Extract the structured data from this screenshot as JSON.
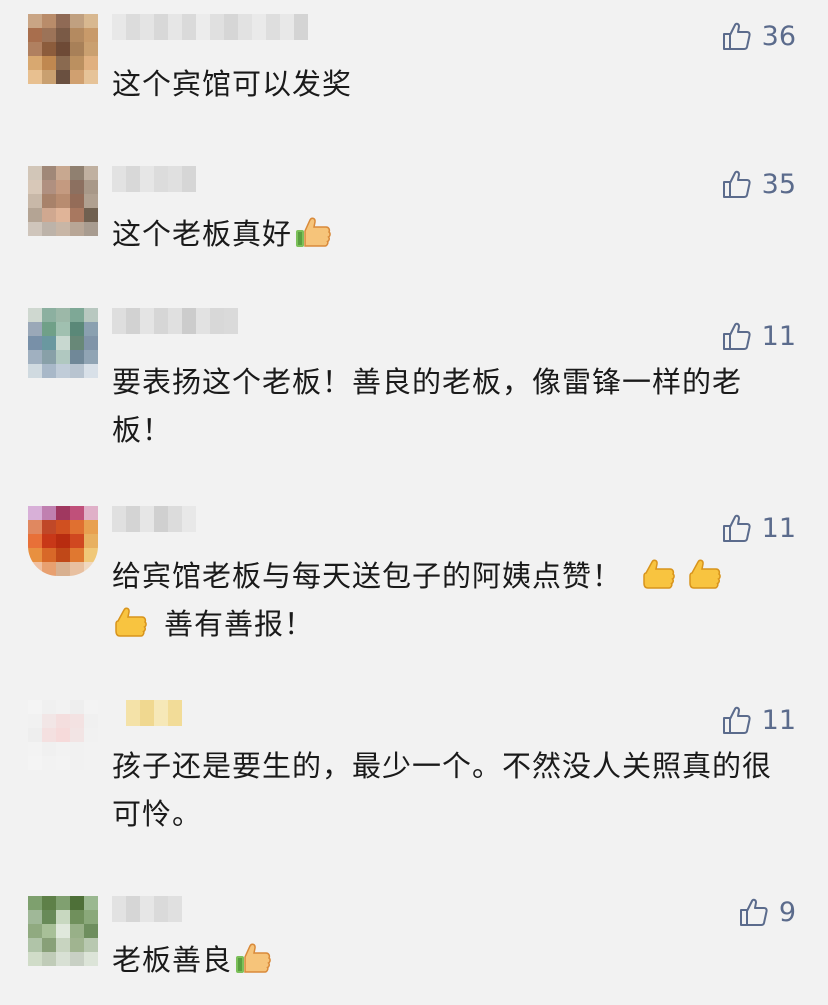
{
  "comments": [
    {
      "text": "这个宾馆可以发奖",
      "likes": "36",
      "emoji": 0,
      "avatar": [
        "#c9a585",
        "#b98c6a",
        "#8f6a55",
        "#c0a080",
        "#d8b890",
        "#a86e4d",
        "#9c7358",
        "#7a5a46",
        "#b48a60",
        "#c89a6a",
        "#b08060",
        "#8c5c3c",
        "#6e4a36",
        "#a88058",
        "#caa070",
        "#d8a870",
        "#c08850",
        "#8a6a50",
        "#bb9060",
        "#e0b080",
        "#e8c090",
        "#c9a070",
        "#6a5040",
        "#d0a070",
        "#e6c398"
      ],
      "name": [
        "#e8e8e8",
        "#dcdcdc",
        "#e4e4e4",
        "#d8d8d8",
        "#e6e6e6",
        "#dadada",
        "#ececec",
        "#e0e0e0",
        "#d6d6d6",
        "#e2e2e2",
        "#eaeaea",
        "#dedede",
        "#e8e8e8",
        "#d4d4d4"
      ]
    },
    {
      "text": "这个老板真好",
      "likes": "35",
      "emoji": 1,
      "avatar": [
        "#d2c6b8",
        "#a08878",
        "#c8a890",
        "#908070",
        "#c0b0a0",
        "#d8c8b8",
        "#b09080",
        "#c49a80",
        "#8c7060",
        "#a89888",
        "#c8b8a8",
        "#a8826a",
        "#b88c70",
        "#946c58",
        "#b0a090",
        "#b4a494",
        "#d0a890",
        "#e0b498",
        "#a87860",
        "#706050",
        "#cfc5bb",
        "#bdb3a9",
        "#c8b6a6",
        "#b8a696",
        "#a89c90"
      ],
      "name": [
        "#e2e2e2",
        "#d8d8d8",
        "#e6e6e6",
        "#dcdcdc",
        "#e0e0e0",
        "#d6d6d6"
      ]
    },
    {
      "text": "要表扬这个老板！善良的老板，像雷锋一样的老板！",
      "likes": "11",
      "emoji": 0,
      "avatar": [
        "#cfd8d0",
        "#8cb0a0",
        "#9cb8a8",
        "#7ea896",
        "#b8c8c0",
        "#9aa8b8",
        "#70a088",
        "#a0c0b0",
        "#5a8878",
        "#8aa0b0",
        "#7890a8",
        "#6a98a0",
        "#c8d8d0",
        "#688878",
        "#8094a8",
        "#a0b0c0",
        "#88a0a8",
        "#b0c8c0",
        "#708898",
        "#90a4b4",
        "#d0dae0",
        "#a8b8c8",
        "#c0ccd8",
        "#b8c4d0",
        "#d8e0e8"
      ],
      "name": [
        "#dedede",
        "#d2d2d2",
        "#e4e4e4",
        "#d6d6d6",
        "#e0e0e0",
        "#cccccc",
        "#e2e2e2",
        "#d8d8d8",
        "#dadada"
      ]
    },
    {
      "text": "给宾馆老板与每天送包子的阿姨点赞！",
      "text2": "善有善报！",
      "likes": "11",
      "emoji": 2,
      "avatar": [
        "#d8b0d8",
        "#c080b0",
        "#a03860",
        "#c0507a",
        "#e0b0c8",
        "#e08860",
        "#c04828",
        "#d05020",
        "#e07030",
        "#e8a050",
        "#e87038",
        "#c83818",
        "#b82c10",
        "#d04820",
        "#e8b060",
        "#e89040",
        "#d86828",
        "#c04818",
        "#e07830",
        "#f0c878",
        "#f0c0a0",
        "#e8a070",
        "#d8b090",
        "#e8c0a0",
        "#f0d8c0"
      ],
      "name": [
        "#e0e0e0",
        "#d4d4d4",
        "#e6e6e6",
        "#d0d0d0",
        "#dcdcdc",
        "#e8e8e8"
      ]
    },
    {
      "text": "孩子还是要生的，最少一个。不然没人关照真的很可怜。",
      "likes": "11",
      "emoji": 0,
      "avatar": [
        "#f4f4f4",
        "#f0f0f0",
        "#f2f2f2",
        "#eeeeee",
        "#f3f3f3",
        "#f1f1f1",
        "#f2e6e6",
        "#f4dede",
        "#f3e2e2",
        "#f0f0f0",
        "#eeeeee",
        "#f4e0e0",
        "#f6dada",
        "#f2e4e4",
        "#f1f1f1",
        "#f3f3f3",
        "#f0f0f0",
        "#f2f2f2",
        "#f1f1f1",
        "#f2f2f2",
        "#f4f4f4",
        "#f2f2f2",
        "#f3f3f3",
        "#f1f1f1",
        "#f2f2f2"
      ],
      "name": [
        "#f4e2a8",
        "#f0d890",
        "#f6e8b8",
        "#f2dc98"
      ]
    },
    {
      "text": "老板善良",
      "likes": "9",
      "emoji": 1,
      "avatar": [
        "#7ea06e",
        "#5e8048",
        "#80a070",
        "#4e7038",
        "#9ab890",
        "#a0b898",
        "#688a58",
        "#c8d8c0",
        "#70905c",
        "#8aa87a",
        "#90aa80",
        "#a8c098",
        "#e0e8dc",
        "#98b088",
        "#6e8e5e",
        "#b0c4a8",
        "#88a078",
        "#c8d4c0",
        "#a0b490",
        "#b8c8b0",
        "#d0dcc8",
        "#c0ccb8",
        "#d8e0d4",
        "#c8d0c4",
        "#dce4d8"
      ],
      "name": [
        "#e2e2e2",
        "#d6d6d6",
        "#e6e6e6",
        "#dadada",
        "#e0e0e0"
      ]
    }
  ]
}
